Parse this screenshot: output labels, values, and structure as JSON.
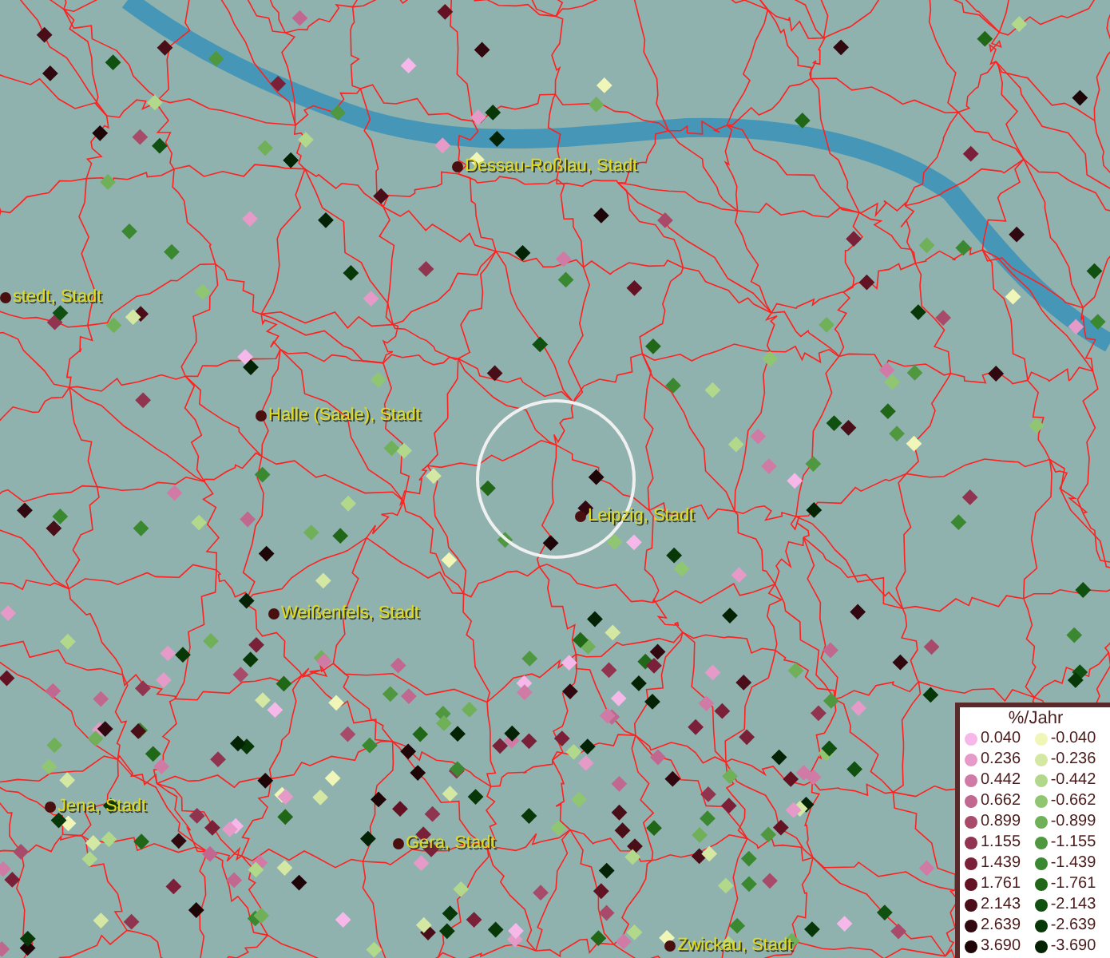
{
  "map": {
    "cities": [
      {
        "name": "Dessau-Roßlau, Stadt"
      },
      {
        "name": "stedt, Stadt"
      },
      {
        "name": "Halle (Saale), Stadt"
      },
      {
        "name": "Leipzig, Stadt"
      },
      {
        "name": "Weißenfels, Stadt"
      },
      {
        "name": "Jena, Stadt"
      },
      {
        "name": "Gera, Stadt"
      },
      {
        "name": "Zwickau, Stadt"
      }
    ]
  },
  "legend": {
    "title": "%/Jahr",
    "rows": [
      {
        "positive": {
          "label": "0.040",
          "color": "#f5b8e8"
        },
        "negative": {
          "label": "-0.040",
          "color": "#f0f5b8"
        }
      },
      {
        "positive": {
          "label": "0.236",
          "color": "#e69ac8"
        },
        "negative": {
          "label": "-0.236",
          "color": "#d4e8a4"
        }
      },
      {
        "positive": {
          "label": "0.442",
          "color": "#d07aa6"
        },
        "negative": {
          "label": "-0.442",
          "color": "#b2d88c"
        }
      },
      {
        "positive": {
          "label": "0.662",
          "color": "#c06890"
        },
        "negative": {
          "label": "-0.662",
          "color": "#90c672"
        }
      },
      {
        "positive": {
          "label": "0.899",
          "color": "#a84a6a"
        },
        "negative": {
          "label": "-0.899",
          "color": "#70b058"
        }
      },
      {
        "positive": {
          "label": "1.155",
          "color": "#903450"
        },
        "negative": {
          "label": "-1.155",
          "color": "#509840"
        }
      },
      {
        "positive": {
          "label": "1.439",
          "color": "#7a2038"
        },
        "negative": {
          "label": "-1.439",
          "color": "#3a8830"
        }
      },
      {
        "positive": {
          "label": "1.761",
          "color": "#621222"
        },
        "negative": {
          "label": "-1.761",
          "color": "#206818"
        }
      },
      {
        "positive": {
          "label": "2.143",
          "color": "#4a0e18"
        },
        "negative": {
          "label": "-2.143",
          "color": "#105010"
        }
      },
      {
        "positive": {
          "label": "2.639",
          "color": "#320810"
        },
        "negative": {
          "label": "-2.639",
          "color": "#083808"
        }
      },
      {
        "positive": {
          "label": "3.690",
          "color": "#1e0508"
        },
        "negative": {
          "label": "-3.690",
          "color": "#042204"
        }
      }
    ]
  }
}
